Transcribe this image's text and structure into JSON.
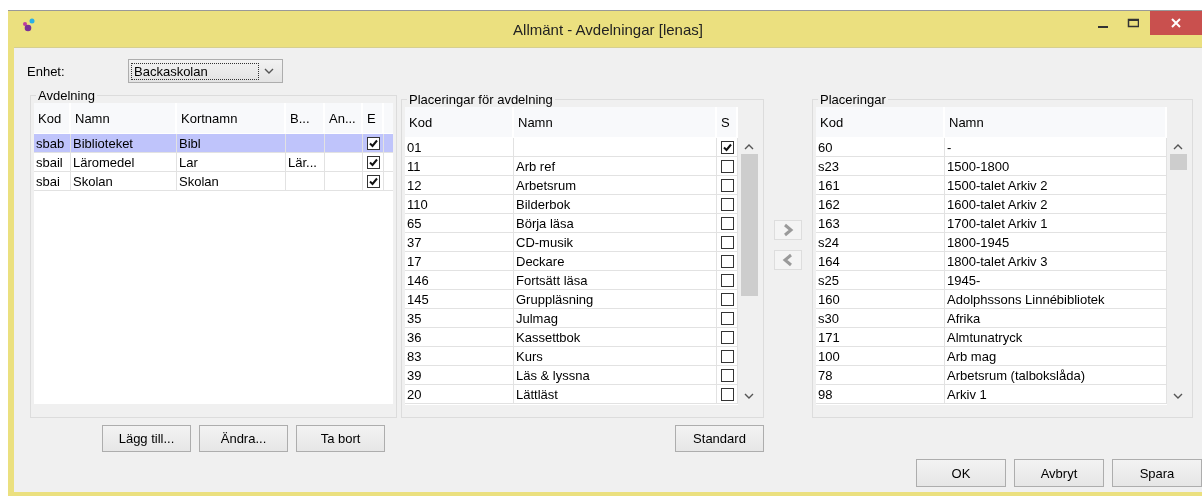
{
  "window": {
    "title": "Allmänt - Avdelningar [lenas]"
  },
  "unit": {
    "label": "Enhet:",
    "value": "Backaskolan"
  },
  "departments": {
    "title": "Avdelning",
    "columns": [
      "Kod",
      "Namn",
      "Kortnamn",
      "B...",
      "An...",
      "E"
    ],
    "rows": [
      {
        "code": "sbab",
        "name": "Biblioteket",
        "short": "Bibl",
        "col_b": "",
        "col_an": "",
        "e": true,
        "selected": true
      },
      {
        "code": "sbail",
        "name": "Läromedel",
        "short": "Lar",
        "col_b": "Lär...",
        "col_an": "",
        "e": true,
        "selected": false
      },
      {
        "code": "sbai",
        "name": "Skolan",
        "short": "Skolan",
        "col_b": "",
        "col_an": "",
        "e": true,
        "selected": false
      }
    ],
    "buttons": [
      "Lägg till...",
      "Ändra...",
      "Ta bort"
    ]
  },
  "dept_locations": {
    "title": "Placeringar för avdelning",
    "columns": [
      "Kod",
      "Namn",
      "S"
    ],
    "rows": [
      {
        "code": "01",
        "name": "",
        "s": true
      },
      {
        "code": "11",
        "name": "Arb ref",
        "s": false
      },
      {
        "code": "12",
        "name": "Arbetsrum",
        "s": false
      },
      {
        "code": "110",
        "name": "Bilderbok",
        "s": false
      },
      {
        "code": "65",
        "name": "Börja läsa",
        "s": false
      },
      {
        "code": "37",
        "name": "CD-musik",
        "s": false
      },
      {
        "code": "17",
        "name": "Deckare",
        "s": false
      },
      {
        "code": "146",
        "name": "Fortsätt läsa",
        "s": false
      },
      {
        "code": "145",
        "name": "Gruppläsning",
        "s": false
      },
      {
        "code": "35",
        "name": "Julmag",
        "s": false
      },
      {
        "code": "36",
        "name": "Kassettbok",
        "s": false
      },
      {
        "code": "83",
        "name": "Kurs",
        "s": false
      },
      {
        "code": "39",
        "name": "Läs & lyssna",
        "s": false
      },
      {
        "code": "20",
        "name": "Lättläst",
        "s": false
      }
    ],
    "button": "Standard"
  },
  "locations": {
    "title": "Placeringar",
    "columns": [
      "Kod",
      "Namn"
    ],
    "rows": [
      {
        "code": "60",
        "name": "-"
      },
      {
        "code": "s23",
        "name": "1500-1800"
      },
      {
        "code": "161",
        "name": "1500-talet Arkiv 2"
      },
      {
        "code": "162",
        "name": "1600-talet Arkiv 2"
      },
      {
        "code": "163",
        "name": "1700-talet Arkiv 1"
      },
      {
        "code": "s24",
        "name": "1800-1945"
      },
      {
        "code": "164",
        "name": "1800-talet Arkiv 3"
      },
      {
        "code": "s25",
        "name": "1945-"
      },
      {
        "code": "160",
        "name": "Adolphssons Linnébibliotek"
      },
      {
        "code": "s30",
        "name": "Afrika"
      },
      {
        "code": "171",
        "name": "Almtunatryck"
      },
      {
        "code": "100",
        "name": "Arb mag"
      },
      {
        "code": "78",
        "name": "Arbetsrum (talbokslåda)"
      },
      {
        "code": "98",
        "name": "Arkiv 1"
      }
    ]
  },
  "footer_buttons": [
    "OK",
    "Avbryt",
    "Spara"
  ]
}
